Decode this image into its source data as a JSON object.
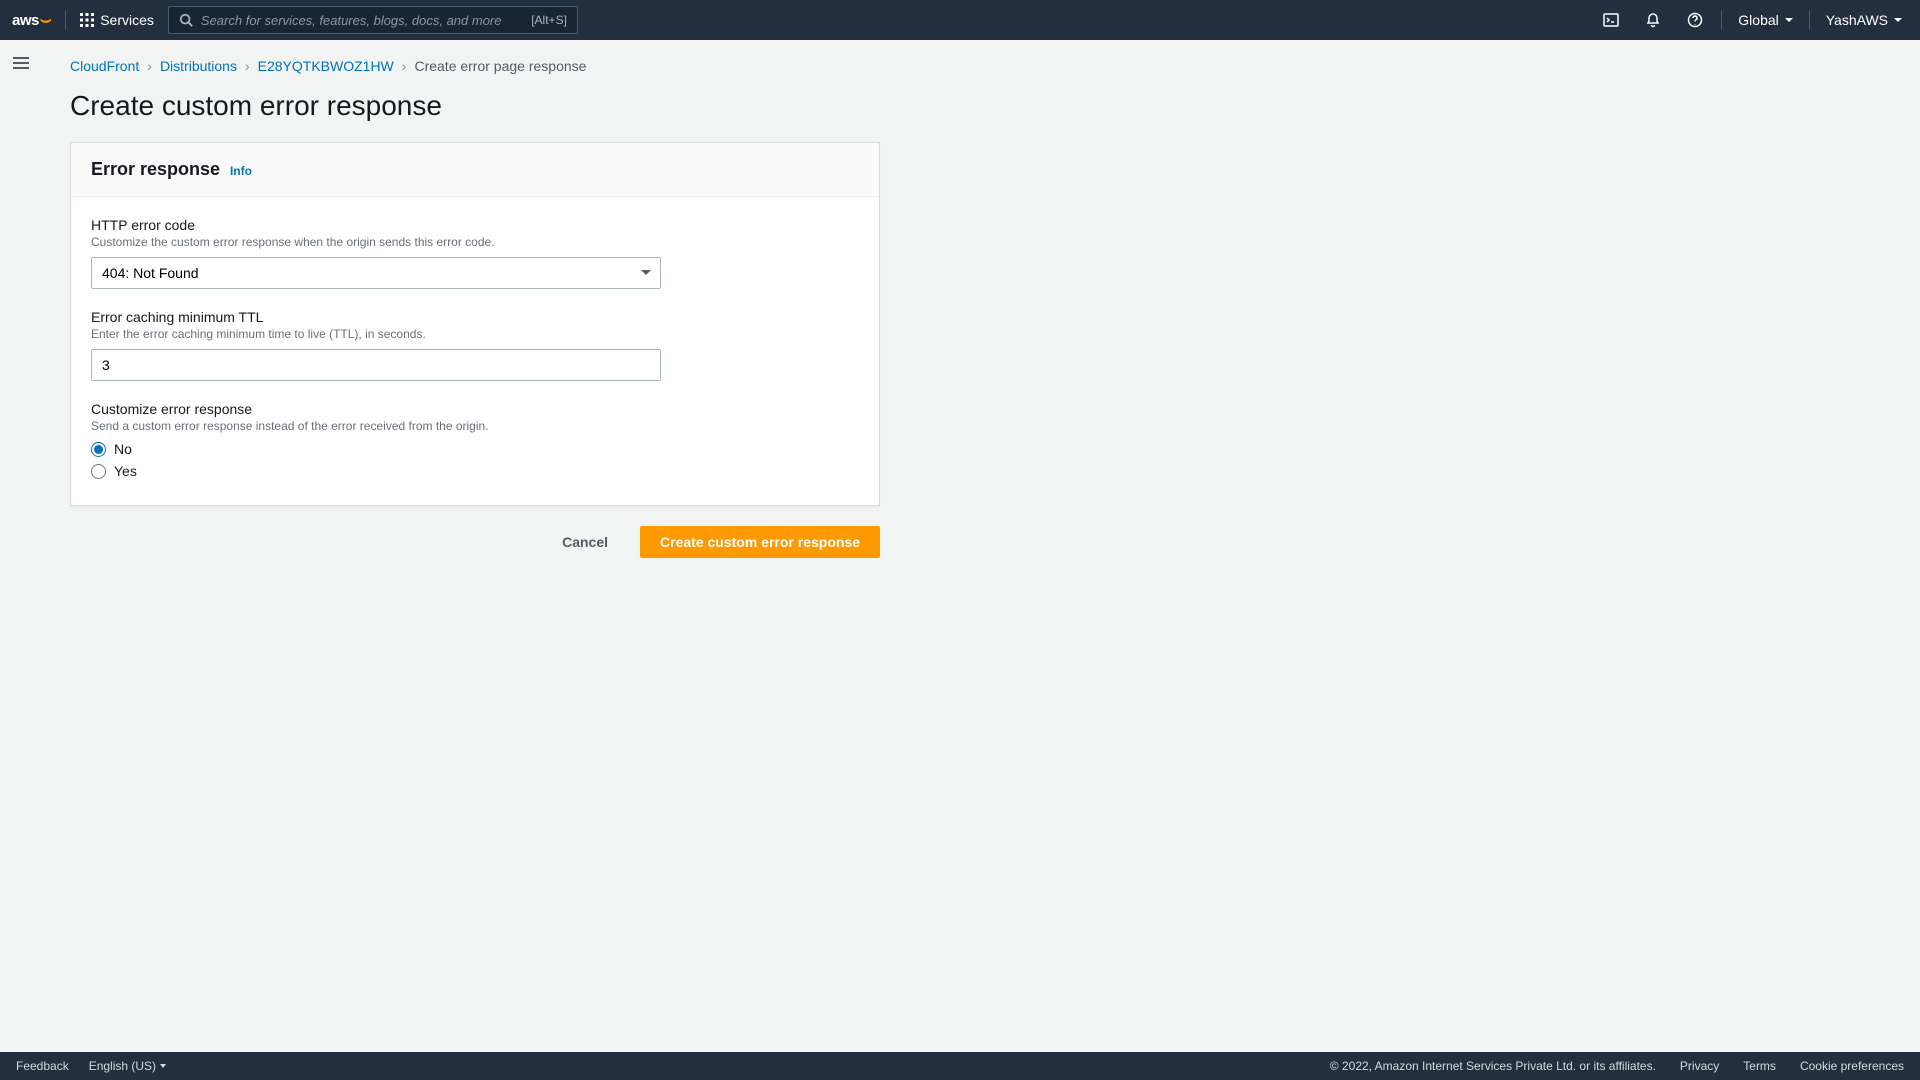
{
  "topnav": {
    "logo_text": "aws",
    "services_label": "Services",
    "search_placeholder": "Search for services, features, blogs, docs, and more",
    "search_shortcut": "[Alt+S]",
    "region_label": "Global",
    "account_label": "YashAWS"
  },
  "breadcrumb": {
    "items": [
      "CloudFront",
      "Distributions",
      "E28YQTKBWOZ1HW"
    ],
    "current": "Create error page response"
  },
  "page_title": "Create custom error response",
  "panel": {
    "title": "Error response",
    "info_label": "Info",
    "http_error": {
      "label": "HTTP error code",
      "desc": "Customize the custom error response when the origin sends this error code.",
      "value": "404: Not Found"
    },
    "ttl": {
      "label": "Error caching minimum TTL",
      "desc": "Enter the error caching minimum time to live (TTL), in seconds.",
      "value": "3"
    },
    "customize": {
      "label": "Customize error response",
      "desc": "Send a custom error response instead of the error received from the origin.",
      "options": {
        "no": "No",
        "yes": "Yes"
      },
      "selected": "no"
    }
  },
  "buttons": {
    "cancel": "Cancel",
    "submit": "Create custom error response"
  },
  "footer": {
    "feedback": "Feedback",
    "language": "English (US)",
    "copyright": "© 2022, Amazon Internet Services Private Ltd. or its affiliates.",
    "links": [
      "Privacy",
      "Terms",
      "Cookie preferences"
    ]
  }
}
